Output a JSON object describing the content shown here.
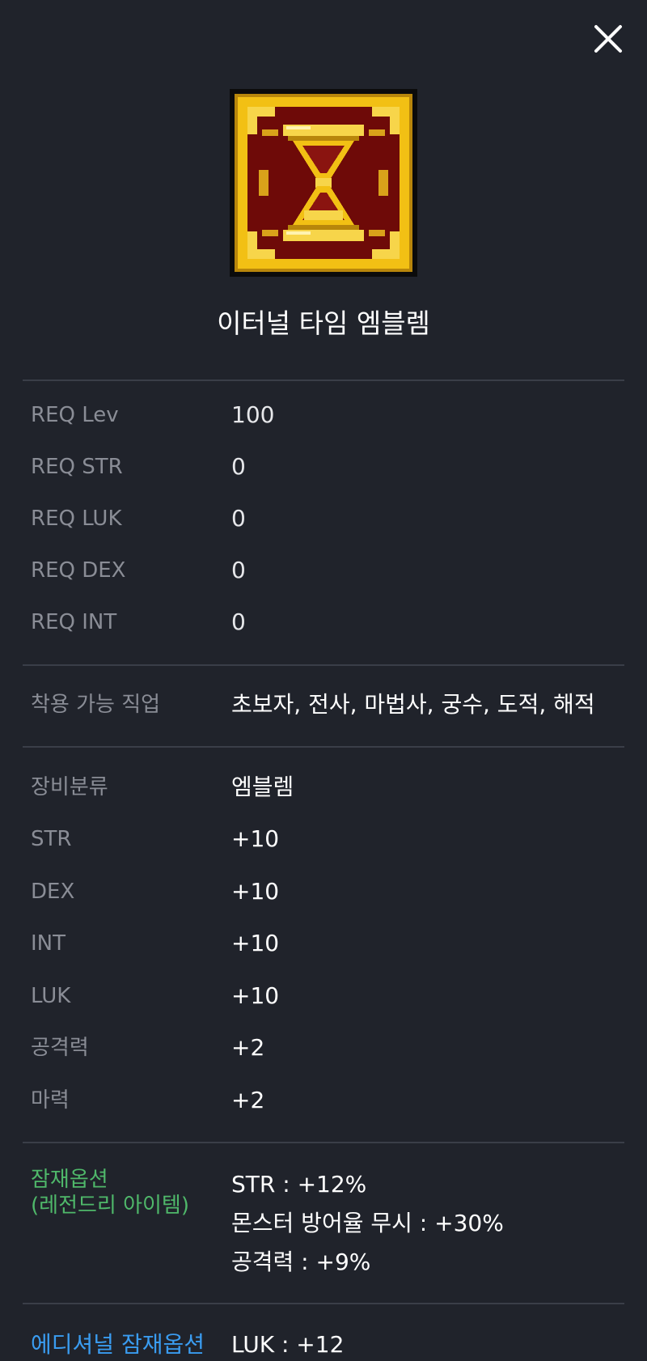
{
  "item": {
    "name": "이터널 타임 엠블렘",
    "icon": "hourglass-emblem-icon",
    "colors": {
      "gold": "#f2c014",
      "dark_red": "#6e0a08",
      "background": "#20232b"
    }
  },
  "close_icon": "close-icon",
  "requirements": [
    {
      "label": "REQ Lev",
      "value": "100"
    },
    {
      "label": "REQ STR",
      "value": "0"
    },
    {
      "label": "REQ LUK",
      "value": "0"
    },
    {
      "label": "REQ DEX",
      "value": "0"
    },
    {
      "label": "REQ INT",
      "value": "0"
    }
  ],
  "jobs": {
    "label": "착용 가능 직업",
    "value": "초보자, 전사, 마법사, 궁수, 도적, 해적"
  },
  "stats": [
    {
      "label": "장비분류",
      "value": "엠블렘"
    },
    {
      "label": "STR",
      "value": "+10"
    },
    {
      "label": "DEX",
      "value": "+10"
    },
    {
      "label": "INT",
      "value": "+10"
    },
    {
      "label": "LUK",
      "value": "+10"
    },
    {
      "label": "공격력",
      "value": "+2"
    },
    {
      "label": "마력",
      "value": "+2"
    }
  ],
  "potential": {
    "label_line1": "잠재옵션",
    "label_line2": "(레전드리 아이템)",
    "label_color": "#4fb86a",
    "lines": [
      "STR : +12%",
      "몬스터 방어율 무시 : +30%",
      "공격력 : +9%"
    ]
  },
  "additional_potential": {
    "label": "에디셔널 잠재옵션",
    "label_color": "#3a9cf0",
    "lines": [
      "LUK : +12"
    ]
  }
}
